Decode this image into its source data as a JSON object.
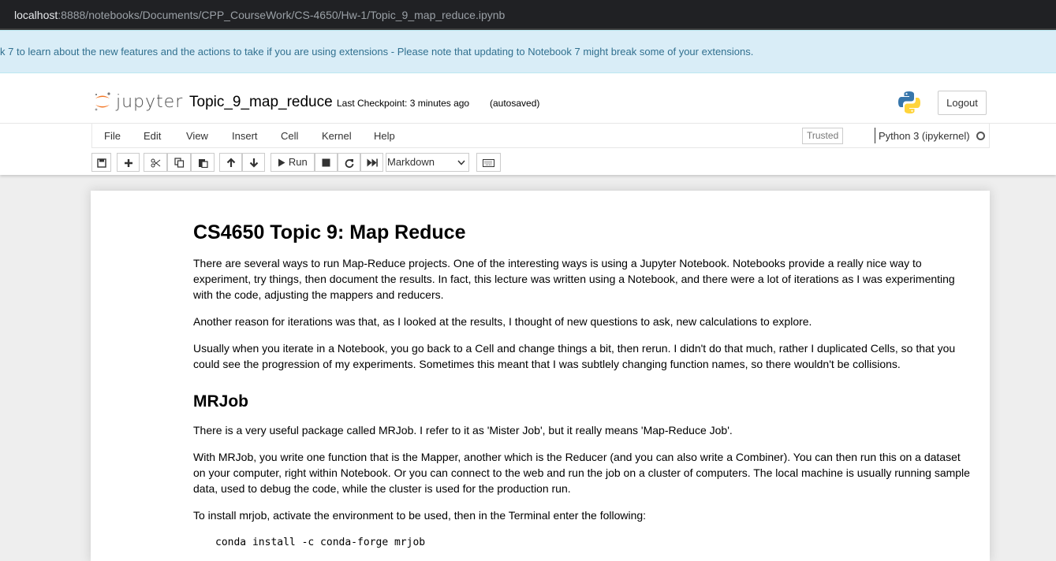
{
  "browser": {
    "url_host": "localhost",
    "url_path": ":8888/notebooks/Documents/CPP_CourseWork/CS-4650/Hw-1/Topic_9_map_reduce.ipynb"
  },
  "notice": {
    "text": "k 7 to learn about the new features and the actions to take if you are using extensions - Please note that updating to Notebook 7 might break some of your extensions."
  },
  "header": {
    "logo_text": "jupyter",
    "notebook_name": "Topic_9_map_reduce",
    "checkpoint": "Last Checkpoint: 3 minutes ago",
    "autosave": "(autosaved)",
    "logout_label": "Logout"
  },
  "menu": {
    "items": [
      "File",
      "Edit",
      "View",
      "Insert",
      "Cell",
      "Kernel",
      "Help"
    ],
    "trusted": "Trusted",
    "kernel": "Python 3 (ipykernel)"
  },
  "toolbar": {
    "run_label": "Run",
    "cell_type": "Markdown"
  },
  "notebook": {
    "title": "CS4650 Topic 9: Map Reduce",
    "p1": "There are several ways to run Map-Reduce projects. One of the interesting ways is using a Jupyter Notebook. Notebooks provide a really nice way to experiment, try things, then document the results. In fact, this lecture was written using a Notebook, and there were a lot of iterations as I was experimenting with the code, adjusting the mappers and reducers.",
    "p2": "Another reason for iterations was that, as I looked at the results, I thought of new questions to ask, new calculations to explore.",
    "p3": "Usually when you iterate in a Notebook, you go back to a Cell and change things a bit, then rerun. I didn't do that much, rather I duplicated Cells, so that you could see the progression of my experiments. Sometimes this meant that I was subtlely changing function names, so there wouldn't be collisions.",
    "h2": "MRJob",
    "p4": "There is a very useful package called MRJob. I refer to it as 'Mister Job', but it really means 'Map-Reduce Job'.",
    "p5": "With MRJob, you write one function that is the Mapper, another which is the Reducer (and you can also write a Combiner). You can then run this on a dataset on your computer, right within Notebook. Or you can connect to the web and run the job on a cluster of computers. The local machine is usually running sample data, used to debug the code, while the cluster is used for the production run.",
    "p6": "To install mrjob, activate the environment to be used, then in the Terminal enter the following:",
    "code": "conda install -c conda-forge mrjob"
  }
}
